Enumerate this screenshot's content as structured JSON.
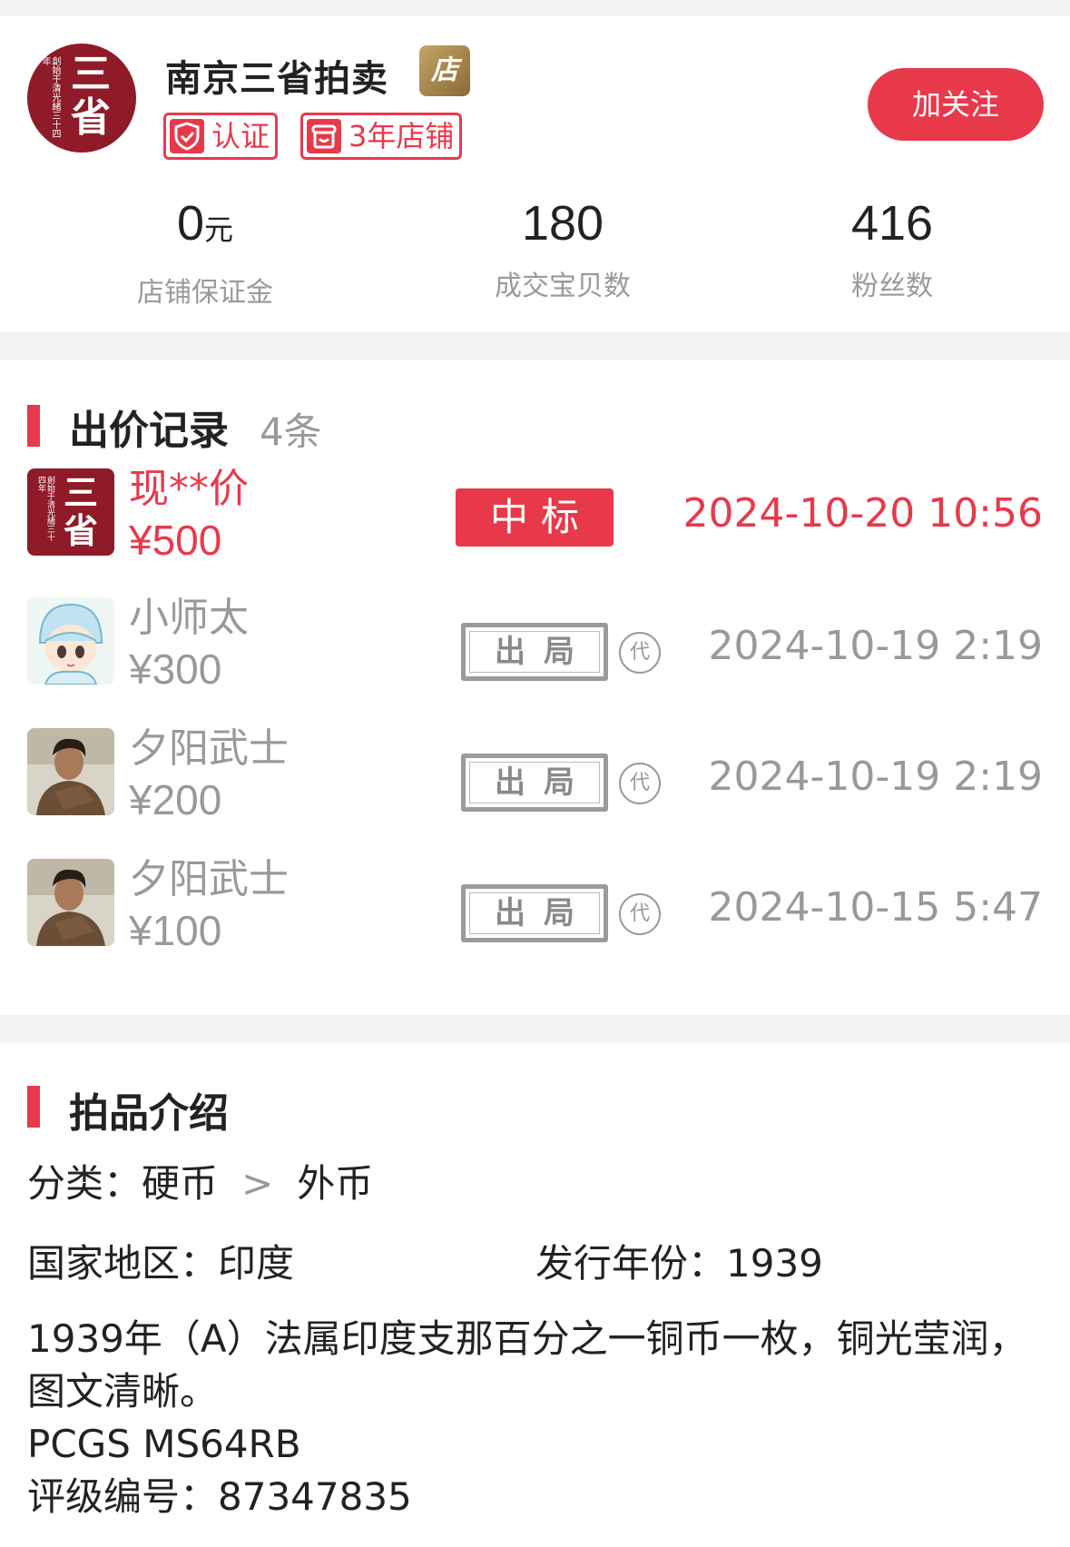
{
  "shop": {
    "logo_text_big": "三省",
    "logo_text_small": "創始于清光緒三十四年",
    "name": "南京三省拍卖",
    "badge_text": "店",
    "tag_verified": "认证",
    "tag_years": "3年店铺",
    "follow_label": "加关注"
  },
  "stats": [
    {
      "value": "0",
      "unit": "元",
      "label": "店铺保证金"
    },
    {
      "value": "180",
      "unit": "",
      "label": "成交宝贝数"
    },
    {
      "value": "416",
      "unit": "",
      "label": "粉丝数"
    }
  ],
  "bids": {
    "title": "出价记录",
    "count": "4条",
    "rows": [
      {
        "name": "现**价",
        "price": "¥500",
        "status": "中标",
        "time": "2024-10-20 10:56",
        "avatar": "shop-logo"
      },
      {
        "name": "小师太",
        "price": "¥300",
        "status": "出局",
        "proxy": "代",
        "time": "2024-10-19 2:19",
        "avatar": "cartoon-nun"
      },
      {
        "name": "夕阳武士",
        "price": "¥200",
        "status": "出局",
        "proxy": "代",
        "time": "2024-10-19 2:19",
        "avatar": "warrior-photo"
      },
      {
        "name": "夕阳武士",
        "price": "¥100",
        "status": "出局",
        "proxy": "代",
        "time": "2024-10-15 5:47",
        "avatar": "warrior-photo"
      }
    ]
  },
  "intro": {
    "title": "拍品介绍",
    "category_label": "分类：",
    "category_main": "硬币",
    "category_sep": ">",
    "category_sub": "外币",
    "region_label": "国家地区：",
    "region_value": "印度",
    "year_label": "发行年份：",
    "year_value": "1939",
    "desc_line1": "1939年（A）法属印度支那百分之一铜币一枚，铜光莹润，图文清晰。",
    "desc_line2": "PCGS MS64RB",
    "desc_line3": "评级编号：87347835"
  },
  "colors": {
    "accent": "#e8394b",
    "logo_bg": "#8e1b27",
    "muted": "#999999"
  }
}
